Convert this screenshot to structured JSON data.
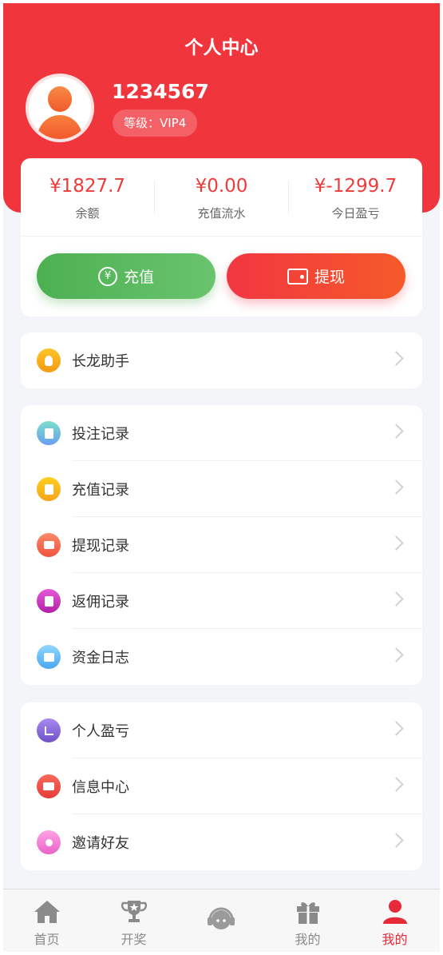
{
  "header": {
    "title": "个人中心"
  },
  "user": {
    "name": "1234567",
    "level": "等级：VIP4"
  },
  "stats": [
    {
      "value": "¥1827.7",
      "label": "余额"
    },
    {
      "value": "¥0.00",
      "label": "充值流水"
    },
    {
      "value": "¥-1299.7",
      "label": "今日盈亏"
    }
  ],
  "actions": {
    "recharge": "充值",
    "withdraw": "提现",
    "recharge_icon": "¥"
  },
  "menu1": [
    {
      "label": "长龙助手",
      "icon": "lightbulb-icon"
    }
  ],
  "menu2": [
    {
      "label": "投注记录",
      "icon": "bet-record-icon"
    },
    {
      "label": "充值记录",
      "icon": "recharge-record-icon"
    },
    {
      "label": "提现记录",
      "icon": "withdraw-record-icon"
    },
    {
      "label": "返佣记录",
      "icon": "rebate-record-icon"
    },
    {
      "label": "资金日志",
      "icon": "fund-log-icon"
    }
  ],
  "menu3": [
    {
      "label": "个人盈亏",
      "icon": "profit-chart-icon"
    },
    {
      "label": "信息中心",
      "icon": "mail-icon"
    },
    {
      "label": "邀请好友",
      "icon": "invite-icon"
    }
  ],
  "tabs": [
    {
      "label": "首页",
      "icon": "home-icon"
    },
    {
      "label": "开奖",
      "icon": "trophy-icon"
    },
    {
      "label": "",
      "icon": "headset-icon"
    },
    {
      "label": "我的",
      "icon": "gift-icon"
    },
    {
      "label": "我的",
      "icon": "user-icon"
    }
  ],
  "colors": {
    "primary": "#f0353d",
    "green": "#4cb051",
    "page_bg": "#f4f5f9",
    "active_tab": "#e62a3a"
  }
}
